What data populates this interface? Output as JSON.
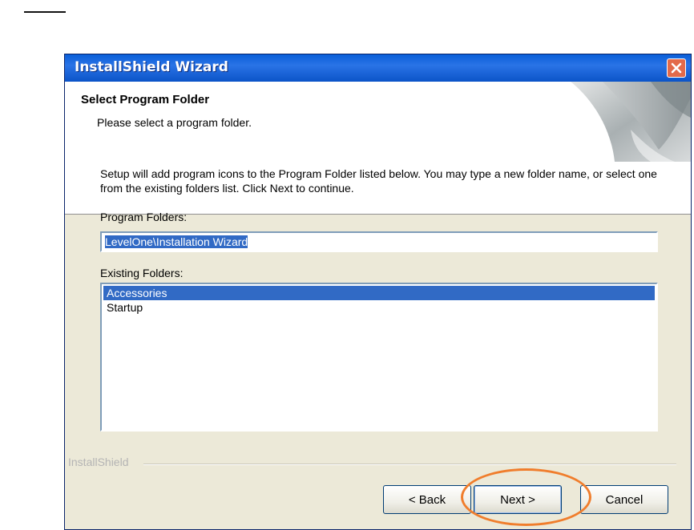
{
  "window": {
    "title": "InstallShield Wizard"
  },
  "header": {
    "title": "Select Program Folder",
    "subtitle": "Please select a program folder."
  },
  "body": {
    "description": "Setup will add program icons to the Program Folder listed below.  You may type a new folder name, or select one from the existing folders list.  Click Next to continue.",
    "program_folders_label": "Program Folders:",
    "program_folder_value": "LevelOne\\Installation Wizard",
    "existing_folders_label": "Existing Folders:",
    "existing_folders": [
      {
        "label": "Accessories",
        "selected": true
      },
      {
        "label": "Startup",
        "selected": false
      }
    ]
  },
  "footer": {
    "brand": "InstallShield",
    "back_label": "< Back",
    "next_label": "Next >",
    "cancel_label": "Cancel"
  },
  "colors": {
    "title_bar": "#0a5fd8",
    "selection": "#316ac5",
    "highlight_ring": "#f07d2c",
    "close_button": "#e36a4a"
  },
  "icons": [
    "close-icon",
    "installshield-header-graphic"
  ]
}
